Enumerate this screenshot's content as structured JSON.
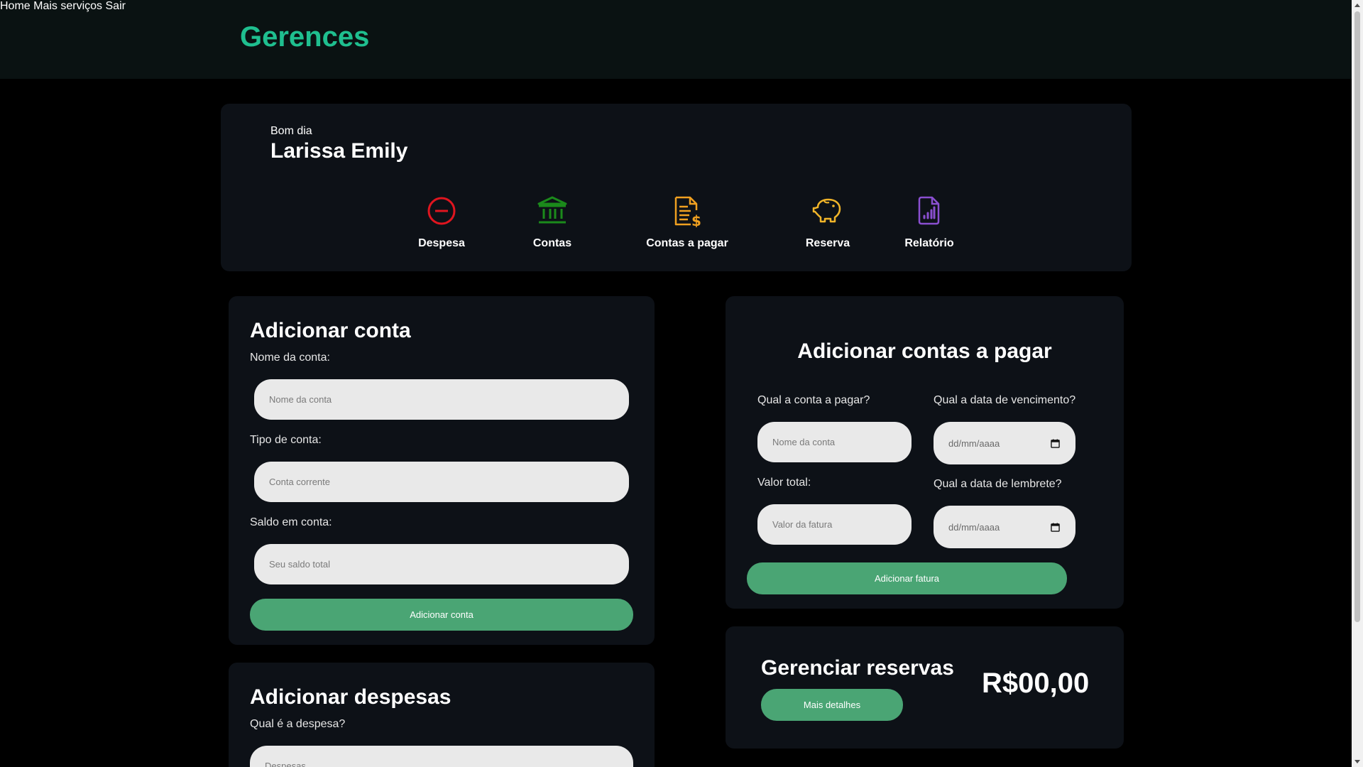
{
  "header": {
    "brand": "Gerences",
    "nav": [
      "Home",
      "Mais serviços",
      "Sair"
    ]
  },
  "greeting": {
    "salutation": "Bom dia",
    "name": "Larissa Emily"
  },
  "shortcuts": [
    {
      "label": "Despesa",
      "icon": "minus-circle-icon",
      "color": "#e0151f"
    },
    {
      "label": "Contas",
      "icon": "bank-icon",
      "color": "#1b8a1b"
    },
    {
      "label": "Contas a pagar",
      "icon": "invoice-dollar-icon",
      "color": "#f0a020"
    },
    {
      "label": "Reserva",
      "icon": "piggy-bank-icon",
      "color": "#f0b429"
    },
    {
      "label": "Relatório",
      "icon": "report-chart-icon",
      "color": "#8a4fd0"
    }
  ],
  "add_account": {
    "title": "Adicionar conta",
    "name_label": "Nome da conta:",
    "name_placeholder": "Nome da conta",
    "type_label": "Tipo de conta:",
    "type_placeholder": "Conta corrente",
    "balance_label": "Saldo em conta:",
    "balance_placeholder": "Seu saldo total",
    "button": "Adicionar conta"
  },
  "add_expenses": {
    "title": "Adicionar despesas",
    "question_label": "Qual é a despesa?",
    "placeholder": "Despesas"
  },
  "add_bills": {
    "title": "Adicionar contas a pagar",
    "bill_label": "Qual a conta a pagar?",
    "bill_placeholder": "Nome da conta",
    "due_label": "Qual a data de vencimento?",
    "due_placeholder": "dd/mm/aaaa",
    "total_label": "Valor total:",
    "total_placeholder": "Valor da fatura",
    "reminder_label": "Qual a data de lembrete?",
    "reminder_placeholder": "dd/mm/aaaa",
    "button": "Adicionar fatura"
  },
  "reserves": {
    "title": "Gerenciar reservas",
    "button": "Mais detalhes",
    "value": "R$00,00"
  },
  "colors": {
    "brand": "#1fbf8f",
    "button": "#4aa574",
    "panel": "#0d1117",
    "header": "#0a1212"
  }
}
